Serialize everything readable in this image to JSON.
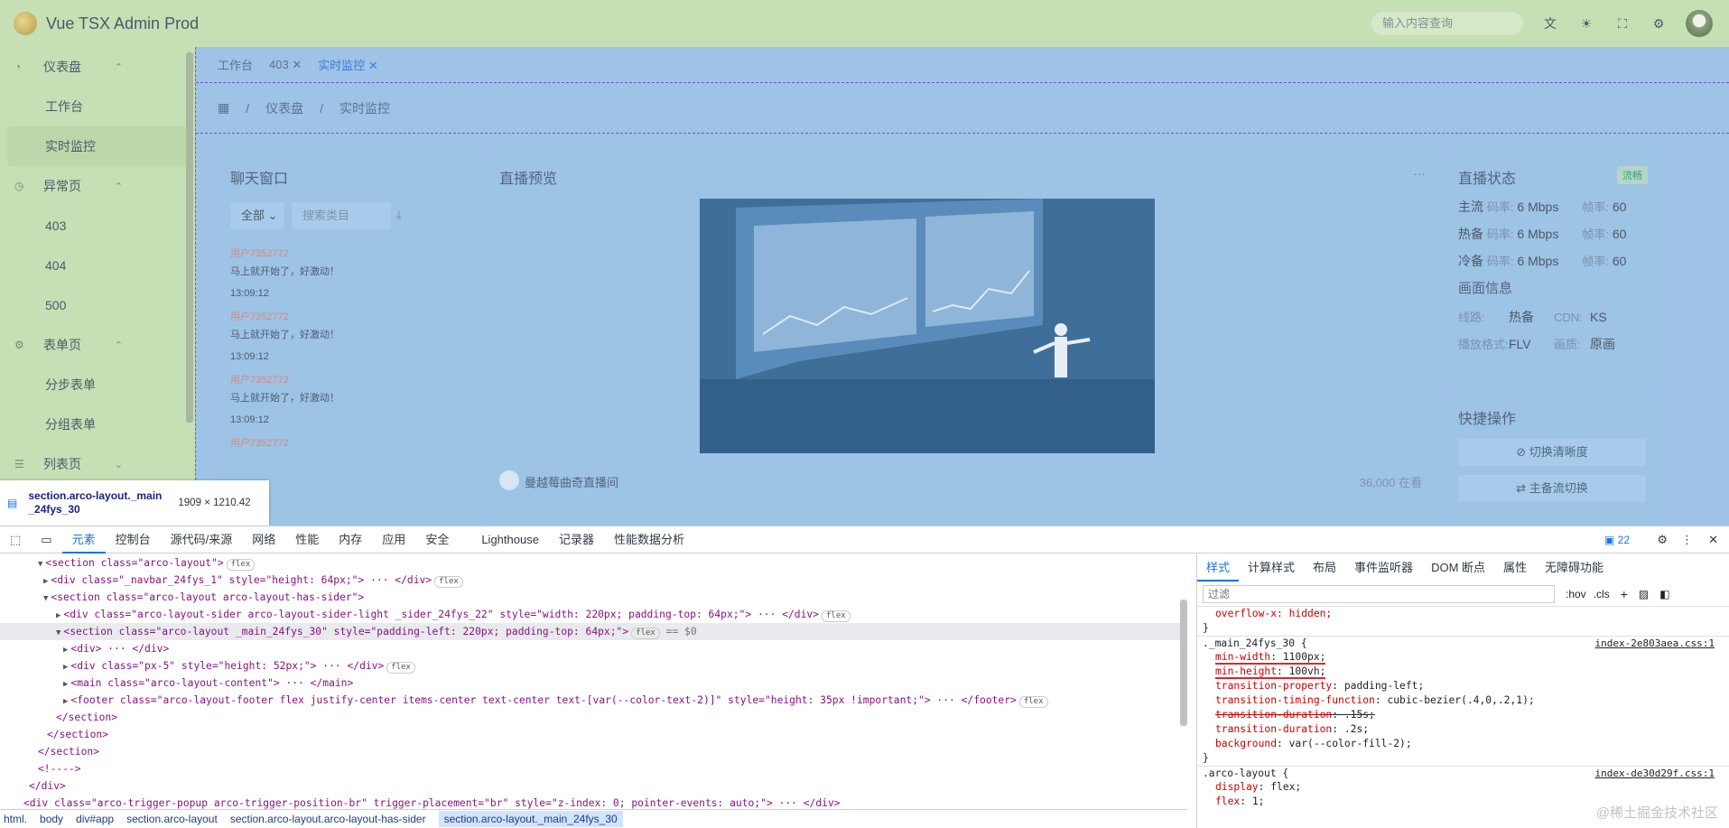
{
  "app": {
    "title": "Vue TSX Admin Prod",
    "search_placeholder": "输入内容查询",
    "icons": [
      "translate-icon",
      "theme-icon",
      "fullscreen-icon",
      "settings-icon",
      "avatar"
    ]
  },
  "sider": {
    "groups": [
      {
        "label": "仪表盘",
        "icon": "dashboard-icon",
        "items": [
          "工作台",
          "实时监控"
        ]
      },
      {
        "label": "异常页",
        "icon": "exception-icon",
        "items": [
          "403",
          "404",
          "500"
        ]
      },
      {
        "label": "表单页",
        "icon": "form-icon",
        "items": [
          "分步表单",
          "分组表单"
        ]
      },
      {
        "label": "列表页",
        "icon": "list-icon",
        "items": []
      }
    ]
  },
  "tabs": [
    "工作台",
    "403",
    "实时监控"
  ],
  "breadcrumb": [
    "仪表盘",
    "实时监控"
  ],
  "chat": {
    "title": "聊天窗口",
    "filter": "全部",
    "search_placeholder": "搜索类目",
    "messages": [
      {
        "user": "用户7352772",
        "text": "马上就开始了，好激动！",
        "time": "13:09:12"
      },
      {
        "user": "用户7352772",
        "text": "马上就开始了，好激动！",
        "time": "13:09:12"
      },
      {
        "user": "用户7352772",
        "text": "马上就开始了，好激动！",
        "time": "13:09:12"
      },
      {
        "user": "用户7352772",
        "text": "",
        "time": ""
      }
    ]
  },
  "live": {
    "title": "直播预览",
    "more": "···",
    "host": "曼越莓曲奇直播间",
    "viewers": "36,000 在看"
  },
  "status": {
    "title": "直播状态",
    "badge": "流畅",
    "rows": [
      {
        "name": "主流",
        "k1": "码率:",
        "v1": "6 Mbps",
        "k2": "帧率:",
        "v2": "60"
      },
      {
        "name": "热备",
        "k1": "码率:",
        "v1": "6 Mbps",
        "k2": "帧率:",
        "v2": "60"
      },
      {
        "name": "冷备",
        "k1": "码率:",
        "v1": "6 Mbps",
        "k2": "帧率:",
        "v2": "60"
      }
    ],
    "picture_title": "画面信息",
    "pic": [
      {
        "k1": "线路:",
        "v1": "热备",
        "k2": "CDN:",
        "v2": "KS"
      },
      {
        "k1": "播放格式:",
        "v1": "FLV",
        "k2": "画质:",
        "v2": "原画"
      }
    ]
  },
  "quick": {
    "title": "快捷操作",
    "buttons": [
      "切换清晰度",
      "主备流切换"
    ]
  },
  "tooltip": {
    "name": "section.arco-layout._main",
    "name2": "_24fys_30",
    "size": "1909 × 1210.42"
  },
  "devtools": {
    "tabs": [
      "元素",
      "控制台",
      "源代码/来源",
      "网络",
      "性能",
      "内存",
      "应用",
      "安全",
      "Lighthouse",
      "记录器",
      "性能数据分析"
    ],
    "issues": "22",
    "crumbs": [
      "html.",
      "body",
      "div#app",
      "section.arco-layout",
      "section.arco-layout.arco-layout-has-sider",
      "section.arco-layout._main_24fys_30"
    ],
    "style_tabs": [
      "样式",
      "计算样式",
      "布局",
      "事件监听器",
      "DOM 断点",
      "属性",
      "无障碍功能"
    ],
    "filter_placeholder": "过滤",
    "hov": ":hov",
    ".cls": ".cls",
    "dom_lines": [
      "<section class=\"arco-layout\">",
      "<div class=\"_navbar_24fys_1\" style=\"height: 64px;\"> ··· </div>",
      "<section class=\"arco-layout arco-layout-has-sider\">",
      "<div class=\"arco-layout-sider arco-layout-sider-light _sider_24fys_22\" style=\"width: 220px; padding-top: 64px;\"> ··· </div>",
      "<section class=\"arco-layout _main_24fys_30\" style=\"padding-left: 220px; padding-top: 64px;\">",
      "<div> ··· </div>",
      "<div class=\"px-5\" style=\"height: 52px;\"> ··· </div>",
      "<main class=\"arco-layout-content\"> ··· </main>",
      "<footer class=\"arco-layout-footer flex justify-center items-center text-center text-[var(--color-text-2)]\" style=\"height: 35px !important;\"> ··· </footer>",
      "</section>",
      "</section>",
      "</section>",
      "<!---->",
      "</div>",
      "<div class=\"arco-trigger-popup arco-trigger-position-br\" trigger-placement=\"br\" style=\"z-index: 0; pointer-events: auto;\"> ··· </div>"
    ],
    "dollar": "== $0",
    "badge": "flex",
    "css": {
      "prev": "overflow-x: hidden;",
      "sel1": "._main_24fys_30 {",
      "src1": "index-2e803aea.css:1",
      "props1": [
        [
          "min-width",
          "1100px;"
        ],
        [
          "min-height",
          "100vh;"
        ],
        [
          "transition-property",
          "padding-left;"
        ],
        [
          "transition-timing-function",
          "cubic-bezier(.4,0,.2,1);"
        ],
        [
          "transition-duration",
          ".15s;"
        ],
        [
          "transition-duration",
          ".2s;"
        ],
        [
          "background",
          "var(--color-fill-2);"
        ]
      ],
      "sel2": ".arco-layout {",
      "src2": "index-de30d29f.css:1",
      "props2": [
        [
          "display",
          "flex;"
        ],
        [
          "flex",
          "1;"
        ]
      ]
    },
    "watermark": "@稀土掘金技术社区"
  }
}
